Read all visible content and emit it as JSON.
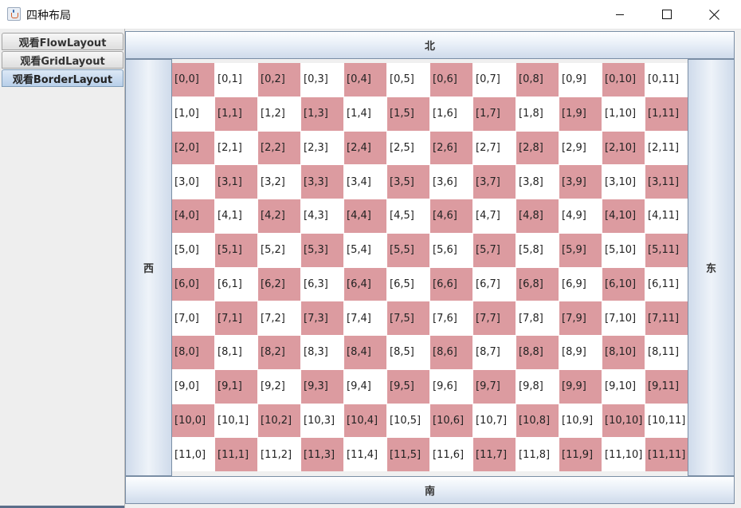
{
  "window": {
    "title": "四种布局",
    "app_icon": "java-cup-icon",
    "controls": {
      "minimize": "minimize-icon",
      "maximize": "maximize-icon",
      "close": "close-icon"
    }
  },
  "tabs": [
    {
      "label": "观看FlowLayout",
      "active": false
    },
    {
      "label": "观看GridLayout",
      "active": false
    },
    {
      "label": "观看BorderLayout",
      "active": true
    }
  ],
  "border_layout": {
    "north": "北",
    "south": "南",
    "west": "西",
    "east": "东"
  },
  "grid": {
    "rows": 12,
    "cols": 12,
    "colors": {
      "highlight": "#dc9ba0",
      "plain": "#ffffff"
    },
    "cells": [
      "[0,0]",
      "[0,1]",
      "[0,2]",
      "[0,3]",
      "[0,4]",
      "[0,5]",
      "[0,6]",
      "[0,7]",
      "[0,8]",
      "[0,9]",
      "[0,10]",
      "[0,11]",
      "[1,0]",
      "[1,1]",
      "[1,2]",
      "[1,3]",
      "[1,4]",
      "[1,5]",
      "[1,6]",
      "[1,7]",
      "[1,8]",
      "[1,9]",
      "[1,10]",
      "[1,11]",
      "[2,0]",
      "[2,1]",
      "[2,2]",
      "[2,3]",
      "[2,4]",
      "[2,5]",
      "[2,6]",
      "[2,7]",
      "[2,8]",
      "[2,9]",
      "[2,10]",
      "[2,11]",
      "[3,0]",
      "[3,1]",
      "[3,2]",
      "[3,3]",
      "[3,4]",
      "[3,5]",
      "[3,6]",
      "[3,7]",
      "[3,8]",
      "[3,9]",
      "[3,10]",
      "[3,11]",
      "[4,0]",
      "[4,1]",
      "[4,2]",
      "[4,3]",
      "[4,4]",
      "[4,5]",
      "[4,6]",
      "[4,7]",
      "[4,8]",
      "[4,9]",
      "[4,10]",
      "[4,11]",
      "[5,0]",
      "[5,1]",
      "[5,2]",
      "[5,3]",
      "[5,4]",
      "[5,5]",
      "[5,6]",
      "[5,7]",
      "[5,8]",
      "[5,9]",
      "[5,10]",
      "[5,11]",
      "[6,0]",
      "[6,1]",
      "[6,2]",
      "[6,3]",
      "[6,4]",
      "[6,5]",
      "[6,6]",
      "[6,7]",
      "[6,8]",
      "[6,9]",
      "[6,10]",
      "[6,11]",
      "[7,0]",
      "[7,1]",
      "[7,2]",
      "[7,3]",
      "[7,4]",
      "[7,5]",
      "[7,6]",
      "[7,7]",
      "[7,8]",
      "[7,9]",
      "[7,10]",
      "[7,11]",
      "[8,0]",
      "[8,1]",
      "[8,2]",
      "[8,3]",
      "[8,4]",
      "[8,5]",
      "[8,6]",
      "[8,7]",
      "[8,8]",
      "[8,9]",
      "[8,10]",
      "[8,11]",
      "[9,0]",
      "[9,1]",
      "[9,2]",
      "[9,3]",
      "[9,4]",
      "[9,5]",
      "[9,6]",
      "[9,7]",
      "[9,8]",
      "[9,9]",
      "[9,10]",
      "[9,11]",
      "[10,0]",
      "[10,1]",
      "[10,2]",
      "[10,3]",
      "[10,4]",
      "[10,5]",
      "[10,6]",
      "[10,7]",
      "[10,8]",
      "[10,9]",
      "[10,10]",
      "[10,11]",
      "[11,0]",
      "[11,1]",
      "[11,2]",
      "[11,3]",
      "[11,4]",
      "[11,5]",
      "[11,6]",
      "[11,7]",
      "[11,8]",
      "[11,9]",
      "[11,10]",
      "[11,11]"
    ]
  }
}
